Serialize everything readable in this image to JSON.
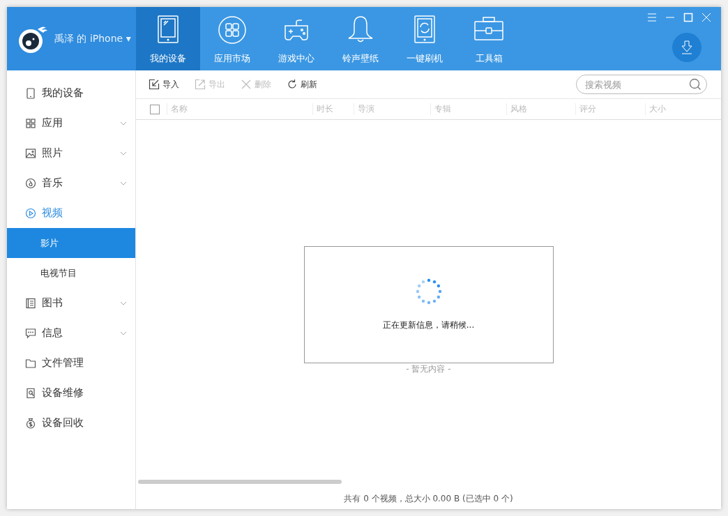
{
  "header": {
    "device_name": "禹泽 的 iPhone",
    "caret": "▾"
  },
  "nav_tabs": [
    {
      "label": "我的设备",
      "selected": true
    },
    {
      "label": "应用市场",
      "selected": false
    },
    {
      "label": "游戏中心",
      "selected": false
    },
    {
      "label": "铃声壁纸",
      "selected": false
    },
    {
      "label": "一键刷机",
      "selected": false
    },
    {
      "label": "工具箱",
      "selected": false
    }
  ],
  "sidebar": {
    "items": [
      {
        "label": "我的设备",
        "collapsible": false,
        "selected": false
      },
      {
        "label": "应用",
        "collapsible": true,
        "selected": false
      },
      {
        "label": "照片",
        "collapsible": true,
        "selected": false
      },
      {
        "label": "音乐",
        "collapsible": true,
        "selected": false
      },
      {
        "label": "视频",
        "collapsible": false,
        "expanded": true,
        "selected": false,
        "children": [
          {
            "label": "影片",
            "selected": true
          },
          {
            "label": "电视节目",
            "selected": false
          }
        ]
      },
      {
        "label": "图书",
        "collapsible": true,
        "selected": false
      },
      {
        "label": "信息",
        "collapsible": true,
        "selected": false
      },
      {
        "label": "文件管理",
        "collapsible": false,
        "selected": false
      },
      {
        "label": "设备维修",
        "collapsible": false,
        "selected": false
      },
      {
        "label": "设备回收",
        "collapsible": false,
        "selected": false
      }
    ]
  },
  "toolbar": {
    "buttons": [
      {
        "label": "导入",
        "disabled": false
      },
      {
        "label": "导出",
        "disabled": true
      },
      {
        "label": "删除",
        "disabled": true
      },
      {
        "label": "刷新",
        "disabled": false
      }
    ],
    "search": {
      "placeholder": "搜索视频"
    }
  },
  "table": {
    "select_all_checked": false,
    "columns": [
      "名称",
      "时长",
      "导演",
      "专辑",
      "风格",
      "评分",
      "大小"
    ],
    "empty_text": "- 暂无内容 -"
  },
  "dialog": {
    "message": "正在更新信息，请稍候..."
  },
  "status_bar": "共有 0 个视频，总大小 0.00 B (已选中 0 个)"
}
